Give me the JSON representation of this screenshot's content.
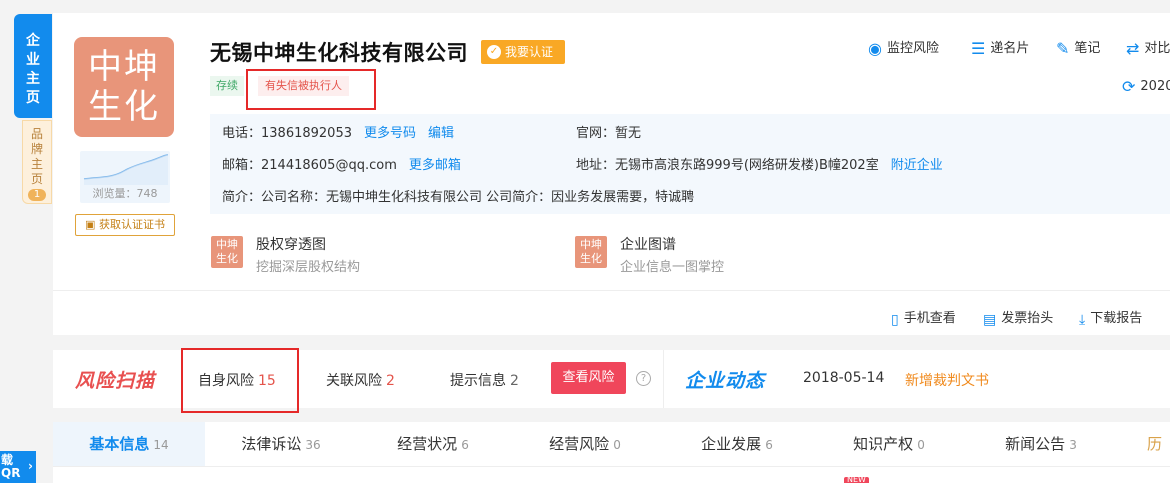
{
  "side_tabs": {
    "main": [
      "企",
      "业",
      "主",
      "页"
    ],
    "brand": [
      "品",
      "牌",
      "主",
      "页"
    ],
    "brand_count": "1"
  },
  "company": {
    "logo_text": [
      "中坤",
      "生化"
    ],
    "name": "无锡中坤生化科技有限公司",
    "verify_label": "我要认证",
    "status_tag": "存续",
    "risk_tag": "有失信被执行人",
    "views_label": "浏览量：748",
    "cert_label": "获取认证证书"
  },
  "contact": {
    "phone_label": "电话：",
    "phone": "13861892053",
    "more_phone": "更多号码",
    "edit": "编辑",
    "website_label": "官网：",
    "website": "暂无",
    "email_label": "邮箱：",
    "email": "214418605@qq.com",
    "more_email": "更多邮箱",
    "address_label": "地址：",
    "address": "无锡市高浪东路999号(网络研发楼)B幢202室",
    "nearby": "附近企业",
    "intro_label": "简介：",
    "intro": "公司名称：无锡中坤生化科技有限公司 公司简介：因业务发展需要，特诚聘"
  },
  "features": [
    {
      "icon_text": [
        "中坤",
        "生化"
      ],
      "title": "股权穿透图",
      "sub": "挖掘深层股权结构"
    },
    {
      "icon_text": [
        "中坤",
        "生化"
      ],
      "title": "企业图谱",
      "sub": "企业信息一图掌控"
    }
  ],
  "header_actions": {
    "monitor": "监控风险",
    "card": "递名片",
    "note": "笔记",
    "compare": "对比",
    "refresh_year": "2020"
  },
  "footer_actions": {
    "mobile": "手机查看",
    "invoice": "发票抬头",
    "report": "下载报告"
  },
  "risk": {
    "logo": "风险扫描",
    "self_label": "自身风险",
    "self_count": "15",
    "related_label": "关联风险",
    "related_count": "2",
    "tips_label": "提示信息",
    "tips_count": "2",
    "check_button": "查看风险",
    "help": "?"
  },
  "dynamics": {
    "logo": "企业动态",
    "date": "2018-05-14",
    "text": "新增裁判文书"
  },
  "tabs": [
    {
      "label": "基本信息",
      "count": "14"
    },
    {
      "label": "法律诉讼",
      "count": "36"
    },
    {
      "label": "经营状况",
      "count": "6"
    },
    {
      "label": "经营风险",
      "count": "0"
    },
    {
      "label": "企业发展",
      "count": "6"
    },
    {
      "label": "知识产权",
      "count": "0"
    },
    {
      "label": "新闻公告",
      "count": "3"
    },
    {
      "label": "历",
      "count": ""
    }
  ],
  "new_badge": "NEW",
  "float_download": [
    "载",
    "QR"
  ]
}
